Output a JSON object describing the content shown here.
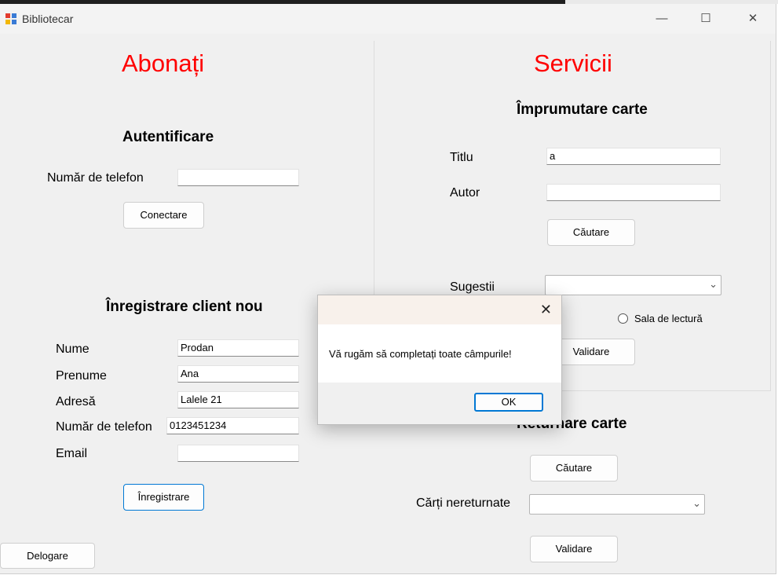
{
  "window": {
    "title": "Bibliotecar",
    "minimize": "—",
    "maximize": "☐",
    "close": "✕"
  },
  "left": {
    "heading": "Abonați",
    "login": {
      "heading": "Autentificare",
      "phone_label": "Număr de telefon",
      "phone_value": "",
      "connect_label": "Conectare"
    },
    "register": {
      "heading": "Înregistrare client nou",
      "name_label": "Nume",
      "name_value": "Prodan",
      "firstname_label": "Prenume",
      "firstname_value": "Ana",
      "address_label": "Adresă",
      "address_value": "Lalele 21",
      "phone_label": "Număr de telefon",
      "phone_value": "0123451234",
      "email_label": "Email",
      "email_value": "",
      "register_label": "Înregistrare"
    },
    "logout_label": "Delogare"
  },
  "right": {
    "heading": "Servicii",
    "borrow": {
      "heading": "Împrumutare carte",
      "title_label": "Titlu",
      "title_value": "a",
      "author_label": "Autor",
      "author_value": "",
      "search_label": "Căutare",
      "suggestions_label": "Sugestii",
      "suggestions_value": "",
      "reading_room_label": "Sala de lectură",
      "validate_label": "Validare"
    },
    "return": {
      "heading": "Returnare carte",
      "search_label": "Căutare",
      "unreturned_label": "Cărți nereturnate",
      "unreturned_value": "",
      "validate_label": "Validare"
    }
  },
  "dialog": {
    "message": "Vă rugăm să completați toate câmpurile!",
    "ok_label": "OK",
    "close": "✕"
  },
  "icons": {
    "chevron": "⌄"
  }
}
